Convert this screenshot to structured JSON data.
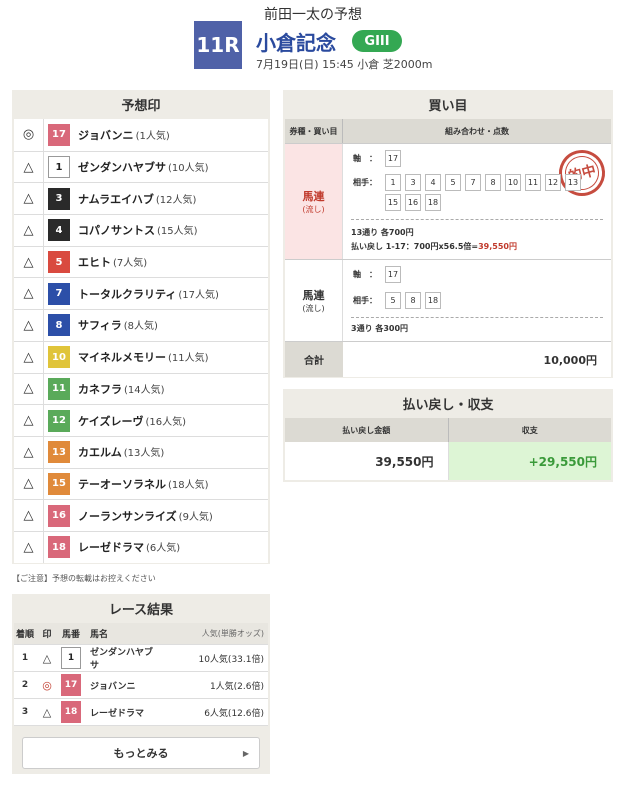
{
  "header": {
    "author": "前田一太の予想",
    "race_no": "11R",
    "race_name": "小倉記念",
    "grade": "GIII",
    "info": "7月19日(日) 15:45 小倉 芝2000m"
  },
  "picks": {
    "title": "予想印",
    "rows": [
      {
        "mark": "◎",
        "num": "17",
        "color": "#d9687a",
        "name": "ジョバンニ",
        "pop": "(1人気)"
      },
      {
        "mark": "△",
        "num": "1",
        "color": "#ffffff",
        "name": "ゼンダンハヤブサ",
        "pop": "(10人気)"
      },
      {
        "mark": "△",
        "num": "3",
        "color": "#2a2a2a",
        "name": "ナムラエイハブ",
        "pop": "(12人気)"
      },
      {
        "mark": "△",
        "num": "4",
        "color": "#2a2a2a",
        "name": "コパノサントス",
        "pop": "(15人気)"
      },
      {
        "mark": "△",
        "num": "5",
        "color": "#d94a3f",
        "name": "エヒト",
        "pop": "(7人気)"
      },
      {
        "mark": "△",
        "num": "7",
        "color": "#2c4fa8",
        "name": "トータルクラリティ",
        "pop": "(17人気)"
      },
      {
        "mark": "△",
        "num": "8",
        "color": "#2c4fa8",
        "name": "サフィラ",
        "pop": "(8人気)"
      },
      {
        "mark": "△",
        "num": "10",
        "color": "#e0c43a",
        "name": "マイネルメモリー",
        "pop": "(11人気)"
      },
      {
        "mark": "△",
        "num": "11",
        "color": "#5aaa5a",
        "name": "カネフラ",
        "pop": "(14人気)"
      },
      {
        "mark": "△",
        "num": "12",
        "color": "#5aaa5a",
        "name": "ケイズレーヴ",
        "pop": "(16人気)"
      },
      {
        "mark": "△",
        "num": "13",
        "color": "#e08a3a",
        "name": "カエルム",
        "pop": "(13人気)"
      },
      {
        "mark": "△",
        "num": "15",
        "color": "#e08a3a",
        "name": "テーオーソラネル",
        "pop": "(18人気)"
      },
      {
        "mark": "△",
        "num": "16",
        "color": "#d9687a",
        "name": "ノーランサンライズ",
        "pop": "(9人気)"
      },
      {
        "mark": "△",
        "num": "18",
        "color": "#d9687a",
        "name": "レーゼドラマ",
        "pop": "(6人気)"
      }
    ]
  },
  "notice": "【ご注意】予想の転載はお控えください",
  "result": {
    "title": "レース結果",
    "headers": {
      "rank": "着順",
      "mark": "印",
      "num": "馬番",
      "name": "馬名",
      "pop": "人気(単勝オッズ)"
    },
    "rows": [
      {
        "rank": "1",
        "mark": "△",
        "num": "1",
        "color": "#ffffff",
        "name": "ゼンダンハヤブサ",
        "pop": "10人気(33.1倍)"
      },
      {
        "rank": "2",
        "mark": "◎",
        "num": "17",
        "color": "#d9687a",
        "name": "ジョバンニ",
        "pop": "1人気(2.6倍)"
      },
      {
        "rank": "3",
        "mark": "△",
        "num": "18",
        "color": "#d9687a",
        "name": "レーゼドラマ",
        "pop": "6人気(12.6倍)"
      }
    ],
    "more": "もっとみる"
  },
  "buys": {
    "title": "買い目",
    "col1": "券種・買い目",
    "col2": "組み合わせ・点数",
    "bet1": {
      "type": "馬連",
      "sub": "(流し)",
      "axis_label": "軸",
      "axis": [
        "17"
      ],
      "partner_label": "相手",
      "partners": [
        "1",
        "3",
        "4",
        "5",
        "7",
        "8",
        "10",
        "11",
        "12",
        "13",
        "15",
        "16",
        "18"
      ],
      "count": "13通り 各700円",
      "payout_prefix": "払い戻し 1-17：700円x56.5倍=",
      "payout_value": "39,550円",
      "stamp": "的中"
    },
    "bet2": {
      "type": "馬連",
      "sub": "(流し)",
      "axis_label": "軸",
      "axis": [
        "17"
      ],
      "partner_label": "相手",
      "partners": [
        "5",
        "8",
        "18"
      ],
      "count": "3通り 各300円"
    },
    "total_label": "合計",
    "total_value": "10,000円"
  },
  "payout": {
    "title": "払い戻し・収支",
    "col1": "払い戻し金額",
    "col2": "収支",
    "amount": "39,550円",
    "balance": "+29,550円"
  }
}
